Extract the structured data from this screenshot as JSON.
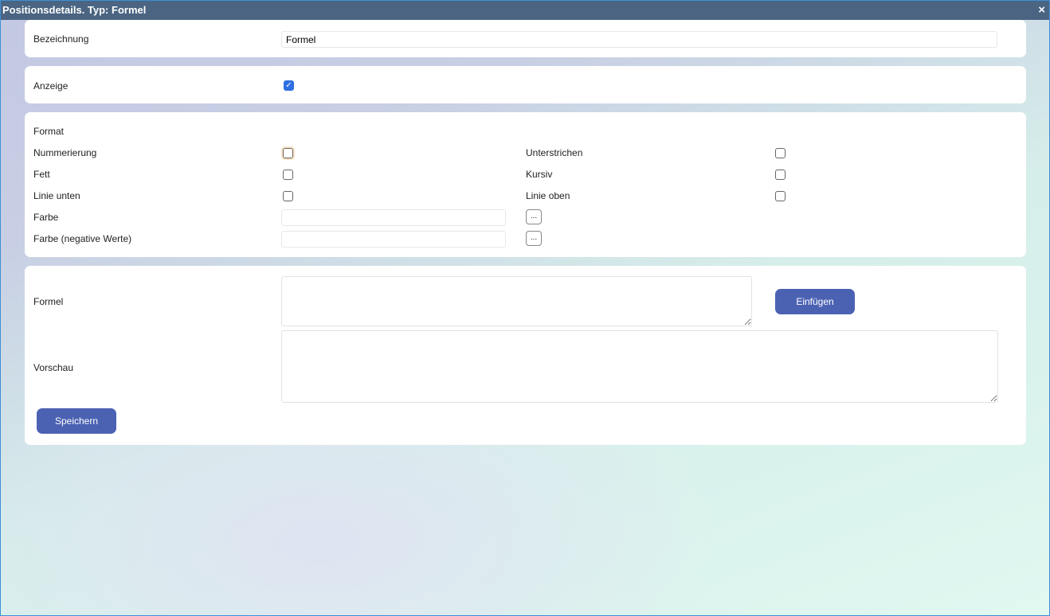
{
  "window": {
    "title": "Positionsdetails. Typ: Formel",
    "close": "×"
  },
  "bezeichnung": {
    "label": "Bezeichnung",
    "value": "Formel"
  },
  "anzeige": {
    "label": "Anzeige",
    "checked": true,
    "check": "✓"
  },
  "format": {
    "heading": "Format",
    "nummerierung": "Nummerierung",
    "unterstrichen": "Unterstrichen",
    "fett": "Fett",
    "kursiv": "Kursiv",
    "linie_unten": "Linie unten",
    "linie_oben": "Linie oben",
    "farbe": "Farbe",
    "farbe_neg": "Farbe (negative Werte)",
    "picker": "..."
  },
  "formel": {
    "label": "Formel",
    "insert": "Einfügen",
    "preview_label": "Vorschau",
    "save": "Speichern"
  }
}
